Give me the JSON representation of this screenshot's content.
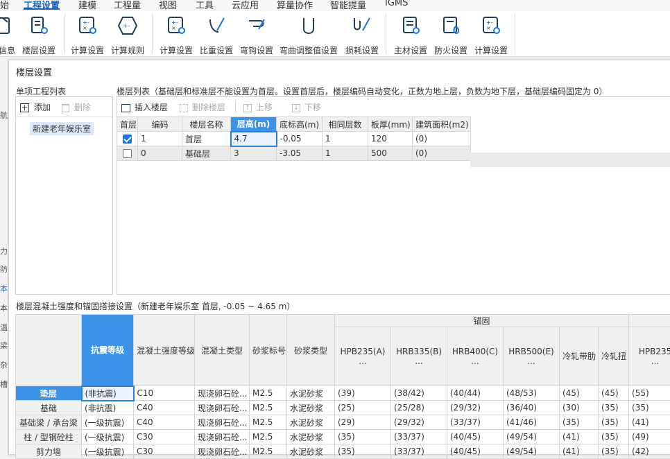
{
  "menu": [
    "始",
    "工程设置",
    "建模",
    "工程量",
    "视图",
    "工具",
    "云应用",
    "算量协作",
    "智能提量",
    "IGMS"
  ],
  "ribbon": {
    "buttons": [
      "信息",
      "楼层设置",
      "计算设置",
      "计算规则",
      "计算设置",
      "比重设置",
      "弯钩设置",
      "弯曲调整值设置",
      "损耗设置",
      "主材设置",
      "防火设置",
      "计算设置"
    ]
  },
  "left_strip": [
    "航",
    "力",
    "防",
    "本",
    "本",
    "温",
    "梁",
    "杂",
    "槽"
  ],
  "dialog": {
    "title": "楼层设置",
    "project_list": {
      "header": "单项工程列表",
      "add_label": "添加",
      "delete_label": "删除",
      "items": [
        "新建老年娱乐室"
      ]
    },
    "floor_list": {
      "header": "楼层列表（基础层和标准层不能设置为首层。设置首层后，楼层编码自动变化，正数为地上层，负数为地下层，基础层编码固定为 0）",
      "toolbar": {
        "insert": "插入楼层",
        "delete": "删除楼层",
        "up": "上移",
        "down": "下移"
      },
      "columns": [
        "首层",
        "编码",
        "楼层名称",
        "层高(m)",
        "底标高(m)",
        "相同层数",
        "板厚(mm)",
        "建筑面积(m2)"
      ],
      "rows": [
        {
          "first": true,
          "code": "1",
          "name": "首层",
          "height": "4.7",
          "bottom": "-0.05",
          "same": "1",
          "slab": "120",
          "area": "(0)"
        },
        {
          "first": false,
          "code": "0",
          "name": "基础层",
          "height": "3",
          "bottom": "-3.05",
          "same": "1",
          "slab": "500",
          "area": "(0)"
        }
      ]
    },
    "concrete": {
      "header": "楼层混凝土强度和锚固搭接设置（新建老年娱乐室 首层, -0.05 ~ 4.65 m）",
      "group_anchor": "锚固",
      "columns": [
        "抗震等级",
        "混凝土强度等级",
        "混凝土类型",
        "砂浆标号",
        "砂浆类型"
      ],
      "anchor_columns": [
        {
          "name": "HPB235(A)",
          "more": "..."
        },
        {
          "name": "HRB335(B)",
          "more": "..."
        },
        {
          "name": "HRB400(C)",
          "more": "..."
        },
        {
          "name": "HRB500(E)",
          "more": "..."
        },
        {
          "name": "冷轧带肋",
          "more": ""
        },
        {
          "name": "冷轧扭",
          "more": ""
        },
        {
          "name": "HPB235",
          "more": "..."
        }
      ],
      "rows": [
        {
          "label": "垫层",
          "seismic": "(非抗震)",
          "strength": "C10",
          "ctype": "现浇卵石砼...",
          "mortar": "M2.5",
          "mtype": "水泥砂浆",
          "vals": [
            "(39)",
            "(38/42)",
            "(40/44)",
            "(48/53)",
            "(45)",
            "(45)",
            "(55)"
          ]
        },
        {
          "label": "基础",
          "seismic": "(非抗震)",
          "strength": "C40",
          "ctype": "现浇卵石砼...",
          "mortar": "M2.5",
          "mtype": "水泥砂浆",
          "vals": [
            "(25)",
            "(25/28)",
            "(29/32)",
            "(36/40)",
            "(30)",
            "(35)",
            "(35)"
          ]
        },
        {
          "label": "基础梁 / 承台梁",
          "seismic": "(一级抗震)",
          "strength": "C40",
          "ctype": "现浇卵石砼...",
          "mortar": "M2.5",
          "mtype": "水泥砂浆",
          "vals": [
            "(29)",
            "(29/32)",
            "(33/37)",
            "(41/46)",
            "(35)",
            "(35)",
            "(41)"
          ]
        },
        {
          "label": "柱 / 型钢砼柱",
          "seismic": "(一级抗震)",
          "strength": "C30",
          "ctype": "现浇卵石砼...",
          "mortar": "M2.5",
          "mtype": "水泥砂浆",
          "vals": [
            "(35)",
            "(33/37)",
            "(40/45)",
            "(49/54)",
            "(41)",
            "(35)",
            "(49)"
          ]
        },
        {
          "label": "剪力墙",
          "seismic": "(一级抗震)",
          "strength": "C30",
          "ctype": "现浇卵石砼...",
          "mortar": "M2.5",
          "mtype": "水泥砂浆",
          "vals": [
            "(35)",
            "(33/37)",
            "(40/45)",
            "(49/54)",
            "(41)",
            "(35)",
            "(42)"
          ]
        }
      ]
    }
  }
}
